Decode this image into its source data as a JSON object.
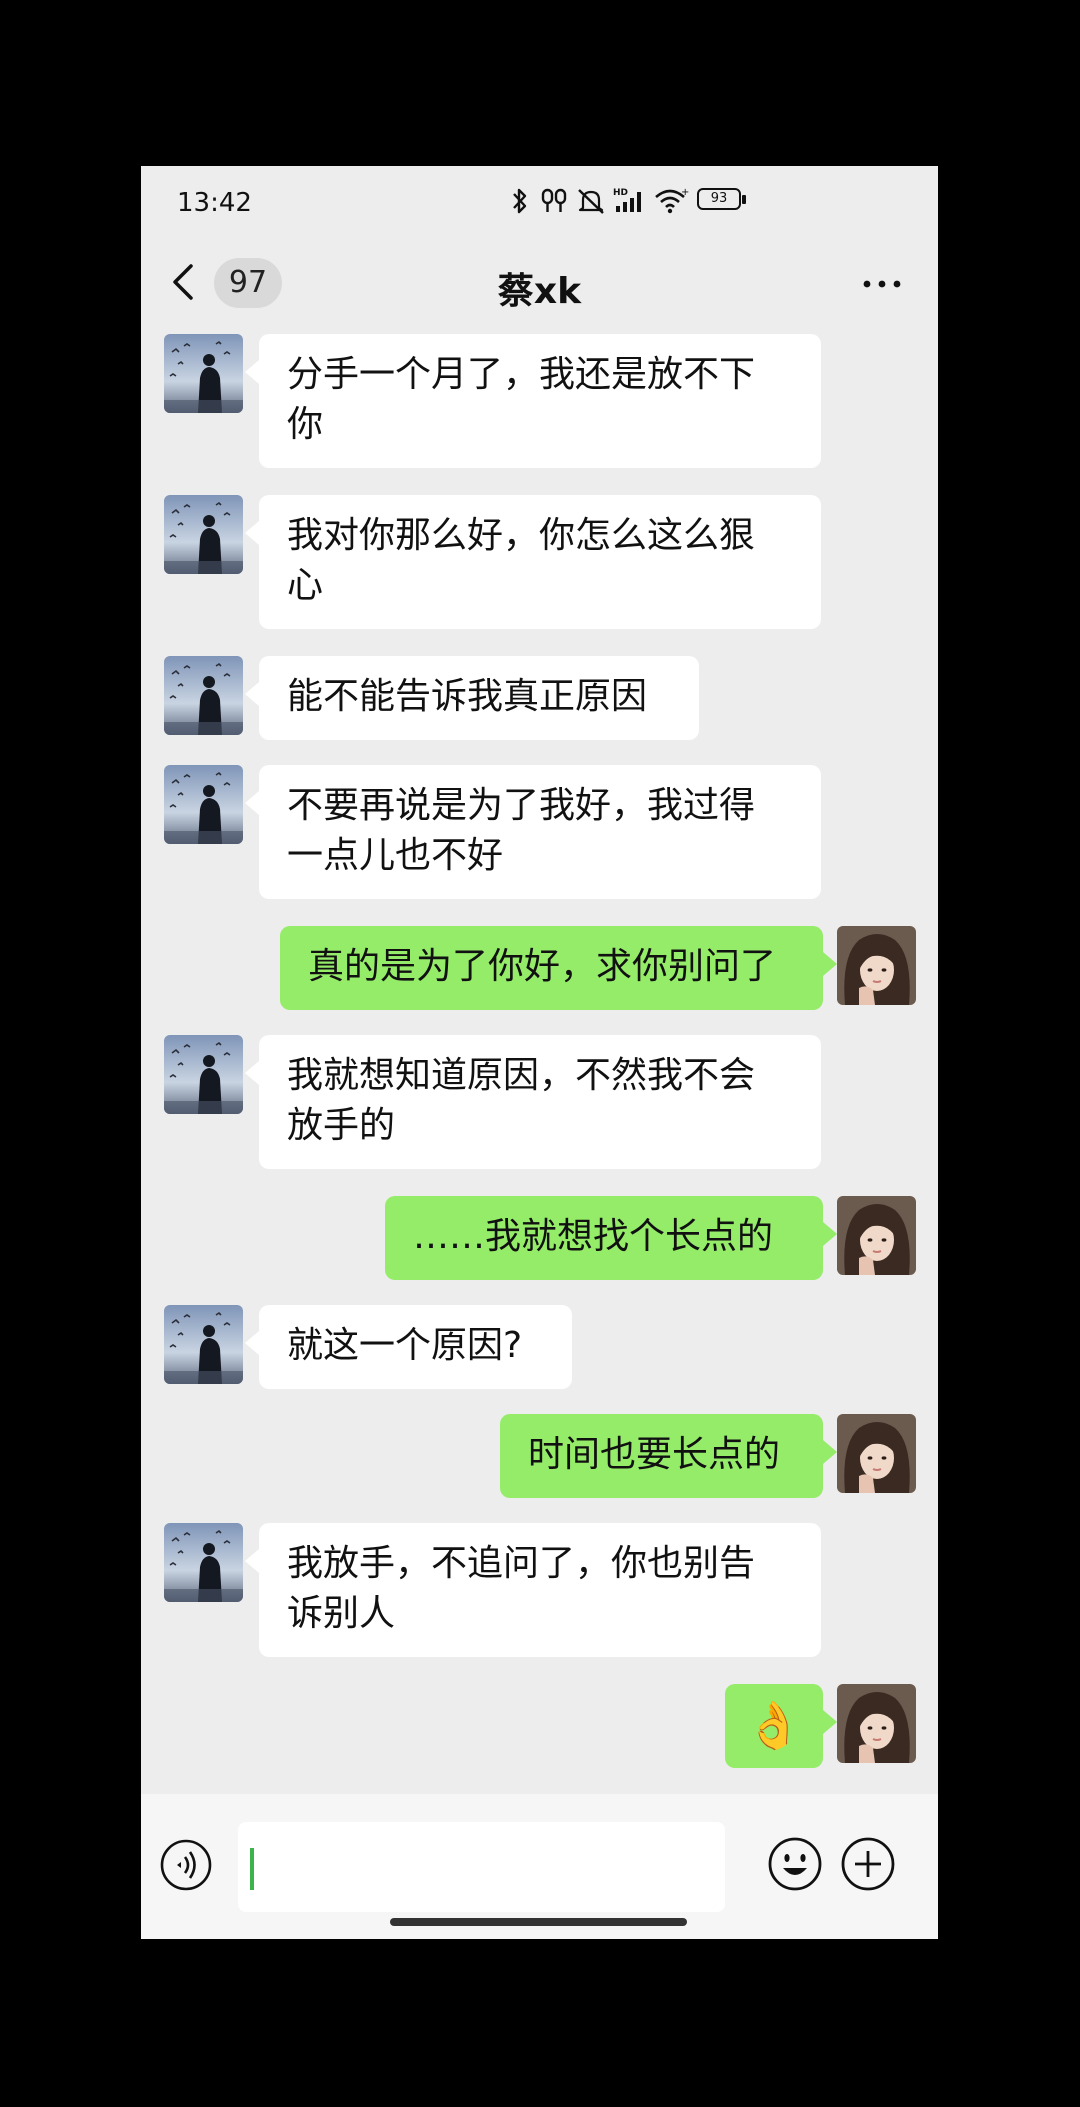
{
  "status_bar": {
    "time": "13:42",
    "battery": "93",
    "icons": [
      "bluetooth-icon",
      "earbuds-icon",
      "mute-icon",
      "hd-signal-icon",
      "wifi-icon",
      "battery-icon"
    ]
  },
  "header": {
    "unread_count": "97",
    "title": "蔡xk",
    "icons": [
      "back-chevron-icon",
      "more-dots-icon"
    ]
  },
  "messages": [
    {
      "side": "received",
      "text_lines": [
        "分手一个月了，我还是放不下",
        "你"
      ]
    },
    {
      "side": "received",
      "text_lines": [
        "我对你那么好，你怎么这么狠",
        "心"
      ]
    },
    {
      "side": "received",
      "text_lines": [
        "能不能告诉我真正原因"
      ]
    },
    {
      "side": "received",
      "text_lines": [
        "不要再说是为了我好，我过得",
        "一点儿也不好"
      ]
    },
    {
      "side": "sent",
      "text_lines": [
        "真的是为了你好，求你别问了"
      ]
    },
    {
      "side": "received",
      "text_lines": [
        "我就想知道原因，不然我不会",
        "放手的"
      ]
    },
    {
      "side": "sent",
      "text_lines": [
        "……我就想找个长点的"
      ]
    },
    {
      "side": "received",
      "text_lines": [
        "就这一个原因?"
      ]
    },
    {
      "side": "sent",
      "text_lines": [
        "时间也要长点的"
      ]
    },
    {
      "side": "received",
      "text_lines": [
        "我放手，不追问了，你也别告",
        "诉别人"
      ]
    },
    {
      "side": "sent",
      "text_lines": [
        "👌"
      ],
      "emoji": "ok-hand-emoji"
    }
  ],
  "input_bar": {
    "value": "",
    "icons": [
      "voice-icon",
      "emoji-icon",
      "plus-icon"
    ]
  },
  "colors": {
    "background": "#ededed",
    "sent_bubble": "#95ec69",
    "received_bubble": "#ffffff",
    "caret": "#3cb44b"
  }
}
